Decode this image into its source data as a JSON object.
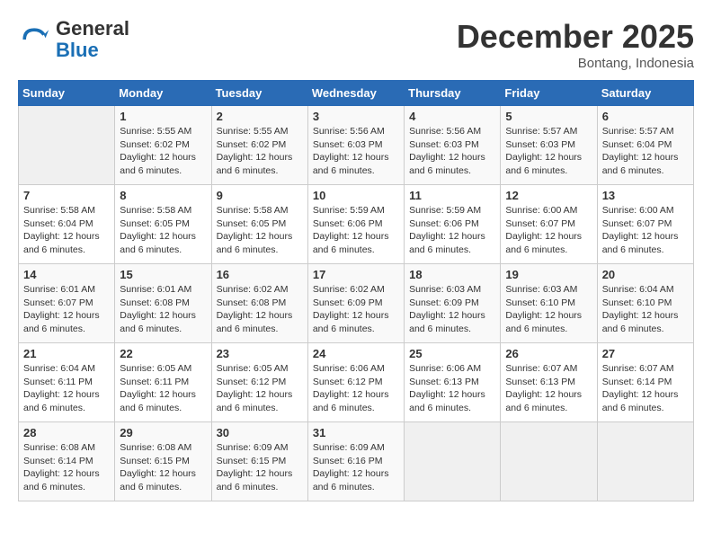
{
  "logo": {
    "general": "General",
    "blue": "Blue"
  },
  "title": "December 2025",
  "location": "Bontang, Indonesia",
  "days_of_week": [
    "Sunday",
    "Monday",
    "Tuesday",
    "Wednesday",
    "Thursday",
    "Friday",
    "Saturday"
  ],
  "weeks": [
    [
      {
        "day": "",
        "sunrise": "",
        "sunset": "",
        "daylight": ""
      },
      {
        "day": "1",
        "sunrise": "Sunrise: 5:55 AM",
        "sunset": "Sunset: 6:02 PM",
        "daylight": "Daylight: 12 hours and 6 minutes."
      },
      {
        "day": "2",
        "sunrise": "Sunrise: 5:55 AM",
        "sunset": "Sunset: 6:02 PM",
        "daylight": "Daylight: 12 hours and 6 minutes."
      },
      {
        "day": "3",
        "sunrise": "Sunrise: 5:56 AM",
        "sunset": "Sunset: 6:03 PM",
        "daylight": "Daylight: 12 hours and 6 minutes."
      },
      {
        "day": "4",
        "sunrise": "Sunrise: 5:56 AM",
        "sunset": "Sunset: 6:03 PM",
        "daylight": "Daylight: 12 hours and 6 minutes."
      },
      {
        "day": "5",
        "sunrise": "Sunrise: 5:57 AM",
        "sunset": "Sunset: 6:03 PM",
        "daylight": "Daylight: 12 hours and 6 minutes."
      },
      {
        "day": "6",
        "sunrise": "Sunrise: 5:57 AM",
        "sunset": "Sunset: 6:04 PM",
        "daylight": "Daylight: 12 hours and 6 minutes."
      }
    ],
    [
      {
        "day": "7",
        "sunrise": "Sunrise: 5:58 AM",
        "sunset": "Sunset: 6:04 PM",
        "daylight": "Daylight: 12 hours and 6 minutes."
      },
      {
        "day": "8",
        "sunrise": "Sunrise: 5:58 AM",
        "sunset": "Sunset: 6:05 PM",
        "daylight": "Daylight: 12 hours and 6 minutes."
      },
      {
        "day": "9",
        "sunrise": "Sunrise: 5:58 AM",
        "sunset": "Sunset: 6:05 PM",
        "daylight": "Daylight: 12 hours and 6 minutes."
      },
      {
        "day": "10",
        "sunrise": "Sunrise: 5:59 AM",
        "sunset": "Sunset: 6:06 PM",
        "daylight": "Daylight: 12 hours and 6 minutes."
      },
      {
        "day": "11",
        "sunrise": "Sunrise: 5:59 AM",
        "sunset": "Sunset: 6:06 PM",
        "daylight": "Daylight: 12 hours and 6 minutes."
      },
      {
        "day": "12",
        "sunrise": "Sunrise: 6:00 AM",
        "sunset": "Sunset: 6:07 PM",
        "daylight": "Daylight: 12 hours and 6 minutes."
      },
      {
        "day": "13",
        "sunrise": "Sunrise: 6:00 AM",
        "sunset": "Sunset: 6:07 PM",
        "daylight": "Daylight: 12 hours and 6 minutes."
      }
    ],
    [
      {
        "day": "14",
        "sunrise": "Sunrise: 6:01 AM",
        "sunset": "Sunset: 6:07 PM",
        "daylight": "Daylight: 12 hours and 6 minutes."
      },
      {
        "day": "15",
        "sunrise": "Sunrise: 6:01 AM",
        "sunset": "Sunset: 6:08 PM",
        "daylight": "Daylight: 12 hours and 6 minutes."
      },
      {
        "day": "16",
        "sunrise": "Sunrise: 6:02 AM",
        "sunset": "Sunset: 6:08 PM",
        "daylight": "Daylight: 12 hours and 6 minutes."
      },
      {
        "day": "17",
        "sunrise": "Sunrise: 6:02 AM",
        "sunset": "Sunset: 6:09 PM",
        "daylight": "Daylight: 12 hours and 6 minutes."
      },
      {
        "day": "18",
        "sunrise": "Sunrise: 6:03 AM",
        "sunset": "Sunset: 6:09 PM",
        "daylight": "Daylight: 12 hours and 6 minutes."
      },
      {
        "day": "19",
        "sunrise": "Sunrise: 6:03 AM",
        "sunset": "Sunset: 6:10 PM",
        "daylight": "Daylight: 12 hours and 6 minutes."
      },
      {
        "day": "20",
        "sunrise": "Sunrise: 6:04 AM",
        "sunset": "Sunset: 6:10 PM",
        "daylight": "Daylight: 12 hours and 6 minutes."
      }
    ],
    [
      {
        "day": "21",
        "sunrise": "Sunrise: 6:04 AM",
        "sunset": "Sunset: 6:11 PM",
        "daylight": "Daylight: 12 hours and 6 minutes."
      },
      {
        "day": "22",
        "sunrise": "Sunrise: 6:05 AM",
        "sunset": "Sunset: 6:11 PM",
        "daylight": "Daylight: 12 hours and 6 minutes."
      },
      {
        "day": "23",
        "sunrise": "Sunrise: 6:05 AM",
        "sunset": "Sunset: 6:12 PM",
        "daylight": "Daylight: 12 hours and 6 minutes."
      },
      {
        "day": "24",
        "sunrise": "Sunrise: 6:06 AM",
        "sunset": "Sunset: 6:12 PM",
        "daylight": "Daylight: 12 hours and 6 minutes."
      },
      {
        "day": "25",
        "sunrise": "Sunrise: 6:06 AM",
        "sunset": "Sunset: 6:13 PM",
        "daylight": "Daylight: 12 hours and 6 minutes."
      },
      {
        "day": "26",
        "sunrise": "Sunrise: 6:07 AM",
        "sunset": "Sunset: 6:13 PM",
        "daylight": "Daylight: 12 hours and 6 minutes."
      },
      {
        "day": "27",
        "sunrise": "Sunrise: 6:07 AM",
        "sunset": "Sunset: 6:14 PM",
        "daylight": "Daylight: 12 hours and 6 minutes."
      }
    ],
    [
      {
        "day": "28",
        "sunrise": "Sunrise: 6:08 AM",
        "sunset": "Sunset: 6:14 PM",
        "daylight": "Daylight: 12 hours and 6 minutes."
      },
      {
        "day": "29",
        "sunrise": "Sunrise: 6:08 AM",
        "sunset": "Sunset: 6:15 PM",
        "daylight": "Daylight: 12 hours and 6 minutes."
      },
      {
        "day": "30",
        "sunrise": "Sunrise: 6:09 AM",
        "sunset": "Sunset: 6:15 PM",
        "daylight": "Daylight: 12 hours and 6 minutes."
      },
      {
        "day": "31",
        "sunrise": "Sunrise: 6:09 AM",
        "sunset": "Sunset: 6:16 PM",
        "daylight": "Daylight: 12 hours and 6 minutes."
      },
      {
        "day": "",
        "sunrise": "",
        "sunset": "",
        "daylight": ""
      },
      {
        "day": "",
        "sunrise": "",
        "sunset": "",
        "daylight": ""
      },
      {
        "day": "",
        "sunrise": "",
        "sunset": "",
        "daylight": ""
      }
    ]
  ]
}
